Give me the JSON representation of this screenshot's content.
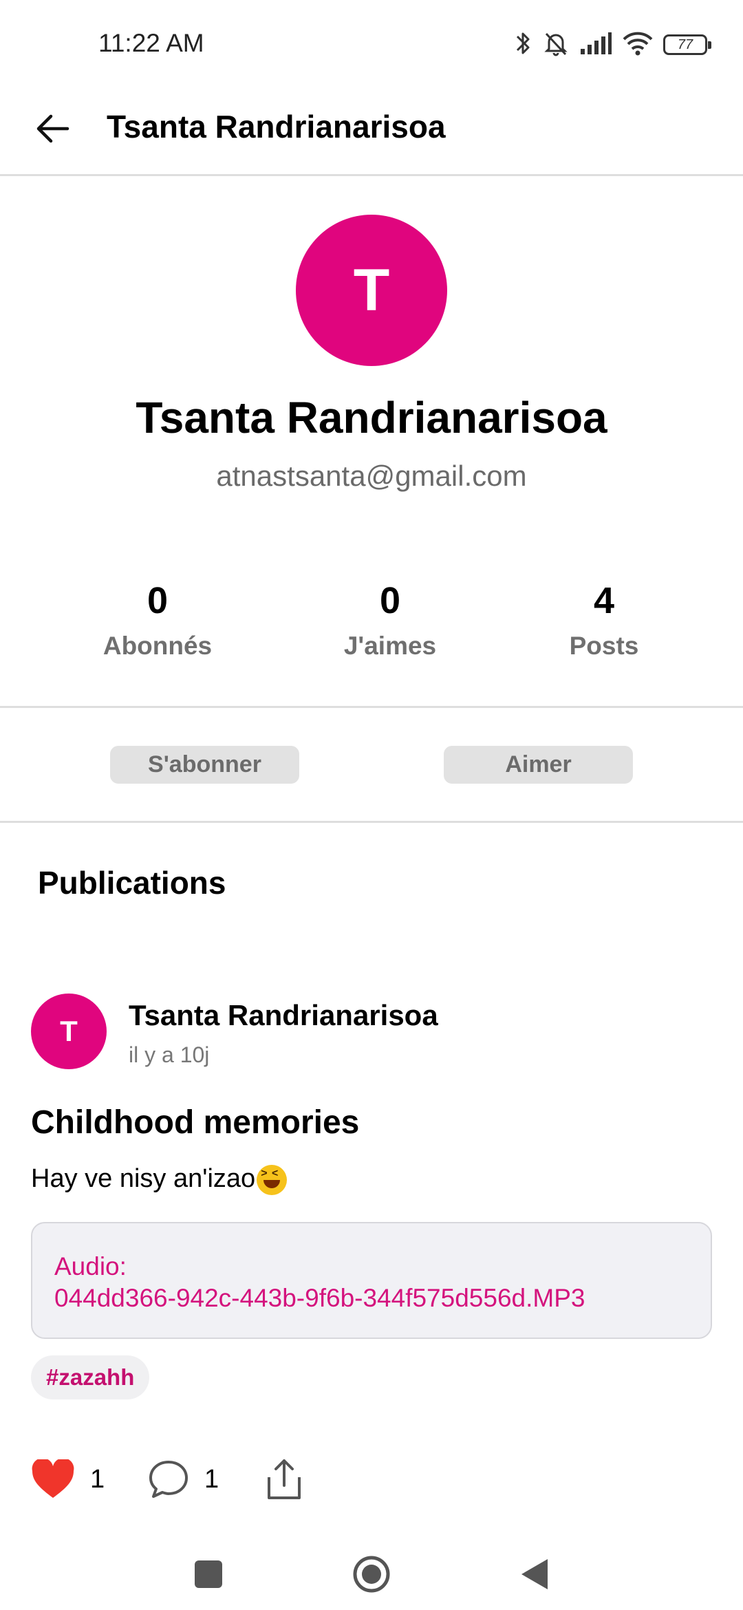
{
  "status_bar": {
    "time": "11:22 AM",
    "battery": "77",
    "icons": [
      "bluetooth-icon",
      "bell-muted-icon",
      "signal-icon",
      "wifi-icon",
      "battery-icon"
    ]
  },
  "app_bar": {
    "title": "Tsanta Randrianarisoa",
    "back_icon": "arrow-left-icon"
  },
  "profile": {
    "avatar_initial": "T",
    "name": "Tsanta Randrianarisoa",
    "email": "atnastsanta@gmail.com",
    "avatar_color": "#e0057e",
    "stats": [
      {
        "value": "0",
        "label": "Abonnés"
      },
      {
        "value": "0",
        "label": "J'aimes"
      },
      {
        "value": "4",
        "label": "Posts"
      }
    ],
    "follow_label": "S'abonner",
    "like_label": "Aimer"
  },
  "publications": {
    "section_title": "Publications",
    "post": {
      "avatar_initial": "T",
      "author": "Tsanta Randrianarisoa",
      "time": "il y a 10j",
      "title": "Childhood memories",
      "body": "Hay ve nisy an'izao",
      "emoji": "laughing-squint-emoji",
      "audio_label": "Audio:",
      "audio_file": "044dd366-942c-443b-9f6b-344f575d556d.MP3",
      "hashtag": "#zazahh",
      "likes": "1",
      "comments": "1",
      "accent_color": "#d4137d"
    }
  },
  "nav_bar": {
    "icons": [
      "recents-square-icon",
      "home-circle-icon",
      "back-triangle-icon"
    ]
  }
}
